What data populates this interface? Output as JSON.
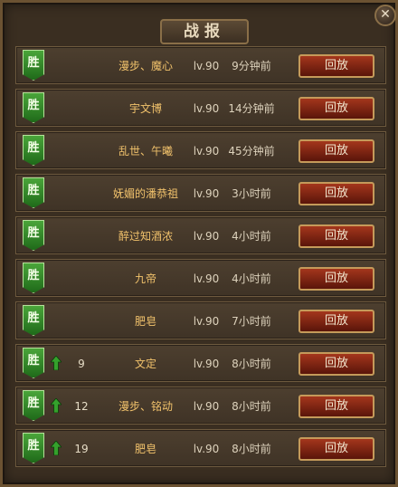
{
  "window": {
    "title": "战报",
    "close_icon": "close-icon"
  },
  "colors": {
    "win_badge": "#3a9a2e",
    "replay_button": "#8a2a14",
    "name_text": "#f0c16b"
  },
  "records": [
    {
      "result": "胜",
      "rank": "",
      "has_up": false,
      "name": "漫步、魔心",
      "level": "lv.90",
      "time": "9分钟前",
      "action": "回放"
    },
    {
      "result": "胜",
      "rank": "",
      "has_up": false,
      "name": "宇文博",
      "level": "lv.90",
      "time": "14分钟前",
      "action": "回放"
    },
    {
      "result": "胜",
      "rank": "",
      "has_up": false,
      "name": "乱世、午曦",
      "level": "lv.90",
      "time": "45分钟前",
      "action": "回放"
    },
    {
      "result": "胜",
      "rank": "",
      "has_up": false,
      "name": "妩媚的潘恭祖",
      "level": "lv.90",
      "time": "3小时前",
      "action": "回放"
    },
    {
      "result": "胜",
      "rank": "",
      "has_up": false,
      "name": "醉过知酒浓",
      "level": "lv.90",
      "time": "4小时前",
      "action": "回放"
    },
    {
      "result": "胜",
      "rank": "",
      "has_up": false,
      "name": "九帝",
      "level": "lv.90",
      "time": "4小时前",
      "action": "回放"
    },
    {
      "result": "胜",
      "rank": "",
      "has_up": false,
      "name": "肥皂",
      "level": "lv.90",
      "time": "7小时前",
      "action": "回放"
    },
    {
      "result": "胜",
      "rank": "9",
      "has_up": true,
      "name": "文定",
      "level": "lv.90",
      "time": "8小时前",
      "action": "回放"
    },
    {
      "result": "胜",
      "rank": "12",
      "has_up": true,
      "name": "漫步、铭动",
      "level": "lv.90",
      "time": "8小时前",
      "action": "回放"
    },
    {
      "result": "胜",
      "rank": "19",
      "has_up": true,
      "name": "肥皂",
      "level": "lv.90",
      "time": "8小时前",
      "action": "回放"
    }
  ]
}
